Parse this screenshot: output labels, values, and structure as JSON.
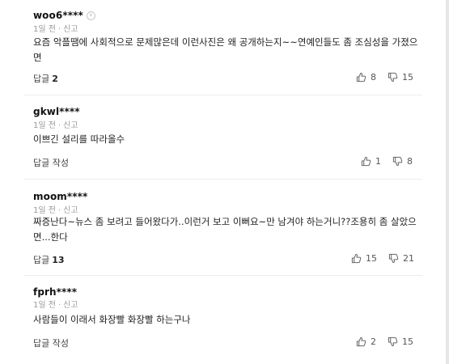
{
  "comments": [
    {
      "user": "woo6****",
      "time": "1일 전",
      "report": "신고",
      "text": "요즘 악플땜에 사회적으로 문제많은데 이런사진은 왜 공개하는지~~연예인들도 좀 조심성을 가졌으면",
      "reply_label": "답글",
      "reply_count": "2",
      "likes": "8",
      "dislikes": "15"
    },
    {
      "user": "gkwl****",
      "time": "1일 전",
      "report": "신고",
      "text": "이쁘긴 설리를 따라올수",
      "reply_label": "답글 작성",
      "reply_count": "",
      "likes": "1",
      "dislikes": "8"
    },
    {
      "user": "moom****",
      "time": "1일 전",
      "report": "신고",
      "text": "짜증난다~뉴스 좀 보려고 들어왔다가..이런거 보고 이뻐요~만 남겨야 하는거니??조용히 좀 살았으면...한다",
      "reply_label": "답글",
      "reply_count": "13",
      "likes": "15",
      "dislikes": "21"
    },
    {
      "user": "fprh****",
      "time": "1일 전",
      "report": "신고",
      "text": "사람들이 이래서 화장빨 화장빨 하는구나",
      "reply_label": "답글 작성",
      "reply_count": "",
      "likes": "2",
      "dislikes": "15"
    }
  ],
  "icons": {
    "profile_chevron": "chevron-right-icon",
    "like": "thumbs-up-icon",
    "dislike": "thumbs-down-icon"
  },
  "colors": {
    "meta_text": "#999999",
    "divider": "#ececec"
  }
}
